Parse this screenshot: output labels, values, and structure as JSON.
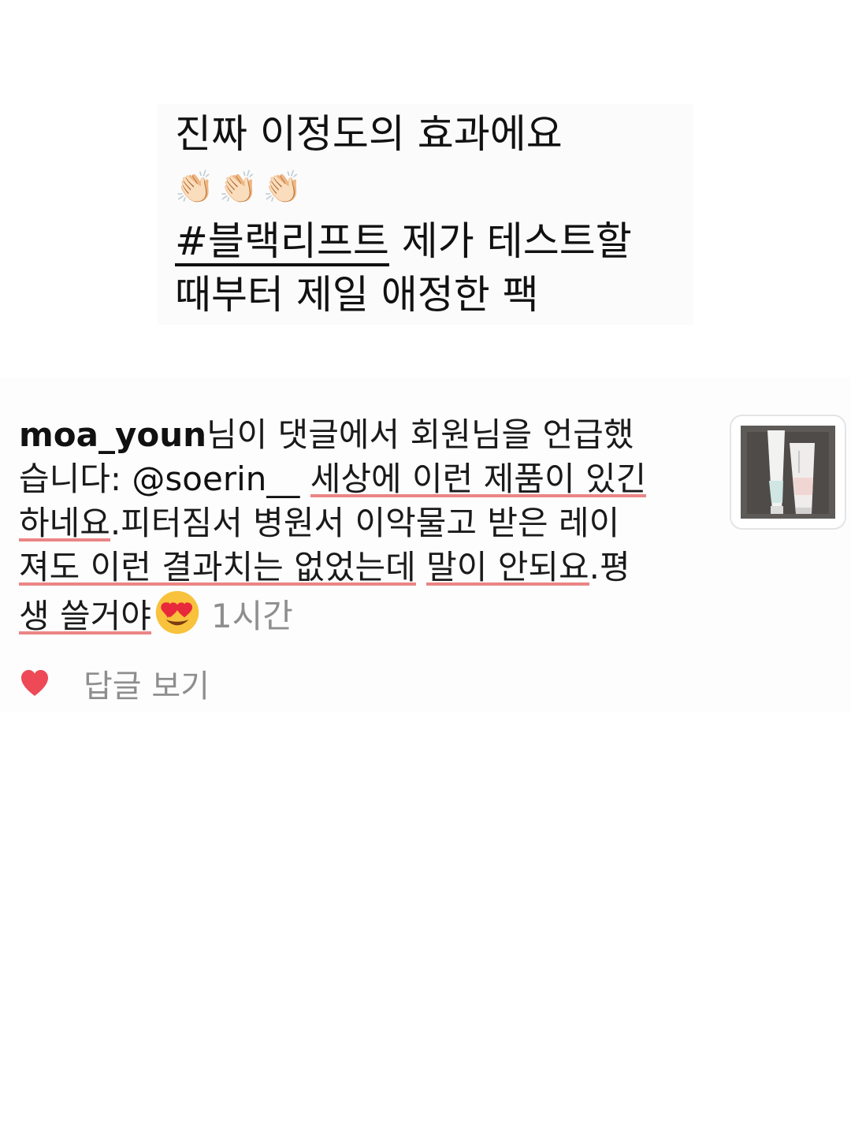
{
  "caption": {
    "line1": "진짜 이정도의 효과에요",
    "claps": "👏🏻👏🏻👏🏻",
    "hashtag": "#블랙리프트",
    "line3_rest": " 제가 테스트할",
    "line4": "때부터 제일 애정한 팩"
  },
  "comment": {
    "username": "moa_youn",
    "l1_rest": "님이 댓글에서 회원님을 언급했",
    "l2_pre": "습니다: ",
    "mention": "@soerin__",
    "l2_space": " ",
    "l2_hl": "세상에 이런 제품이 있긴",
    "l3_hl": "하네요",
    "l3_rest": ".피터짐서 병원서 이악물고 받은 레이",
    "l4_hl1": "져도 이런 결과치는 없었는데",
    "l4_mid": " ",
    "l4_hl2": "말이 안되요",
    "l4_rest": ".평",
    "l5_hl": "생 쓸거야",
    "emoji": "heart-eyes",
    "timestamp": "1시간"
  },
  "actions": {
    "like_icon": "heart-icon",
    "like_color": "#ed4956",
    "reply_label": "답글 보기"
  },
  "thumbnail": {
    "icon": "product-tubes-image"
  },
  "colors": {
    "highlight": "#e87070",
    "secondary_text": "#8e8e8e"
  }
}
